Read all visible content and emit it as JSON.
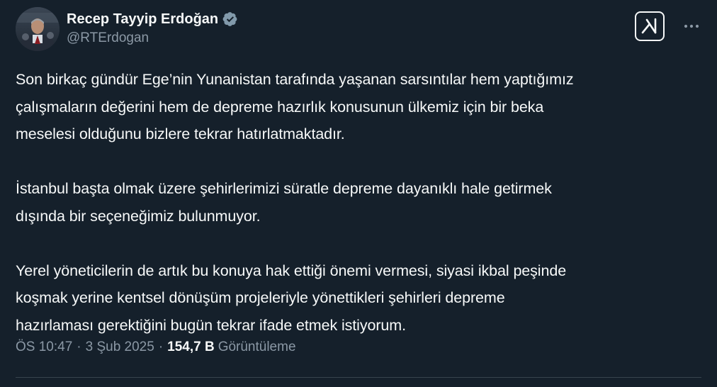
{
  "author": {
    "display_name": "Recep Tayyip Erdoğan",
    "handle": "@RTErdogan",
    "verified_badge": "verified-badge-icon",
    "badge_color": "#829aab"
  },
  "actions": {
    "grok_icon": "grok-icon",
    "more_icon": "more-icon"
  },
  "tweet": {
    "paragraphs": [
      "Son birkaç gündür Ege’nin Yunanistan tarafında yaşanan sarsıntılar hem yaptığımız\nçalışmaların değerini hem de depreme hazırlık konusunun ülkemiz için bir beka\nmeselesi olduğunu bizlere tekrar hatırlatmaktadır.",
      "İstanbul başta olmak üzere şehirlerimizi süratle depreme dayanıklı hale getirmek\ndışında bir seçeneğimiz bulunmuyor.",
      "Yerel yöneticilerin de artık bu konuya hak ettiği önemi vermesi, siyasi ikbal peşinde\nkoşmak yerine kentsel dönüşüm projeleriyle yönettikleri şehirleri depreme\nhazırlaması gerektiğini bugün tekrar ifade etmek istiyorum."
    ],
    "time": "ÖS 10:47",
    "date": "3 Şub 2025",
    "separator": "·",
    "views_count": "154,7 B",
    "views_label": "Görüntüleme"
  },
  "theme": {
    "background": "#15202b",
    "text_primary": "#f7f9f9",
    "text_secondary": "#8b98a5",
    "divider": "#38444d"
  }
}
